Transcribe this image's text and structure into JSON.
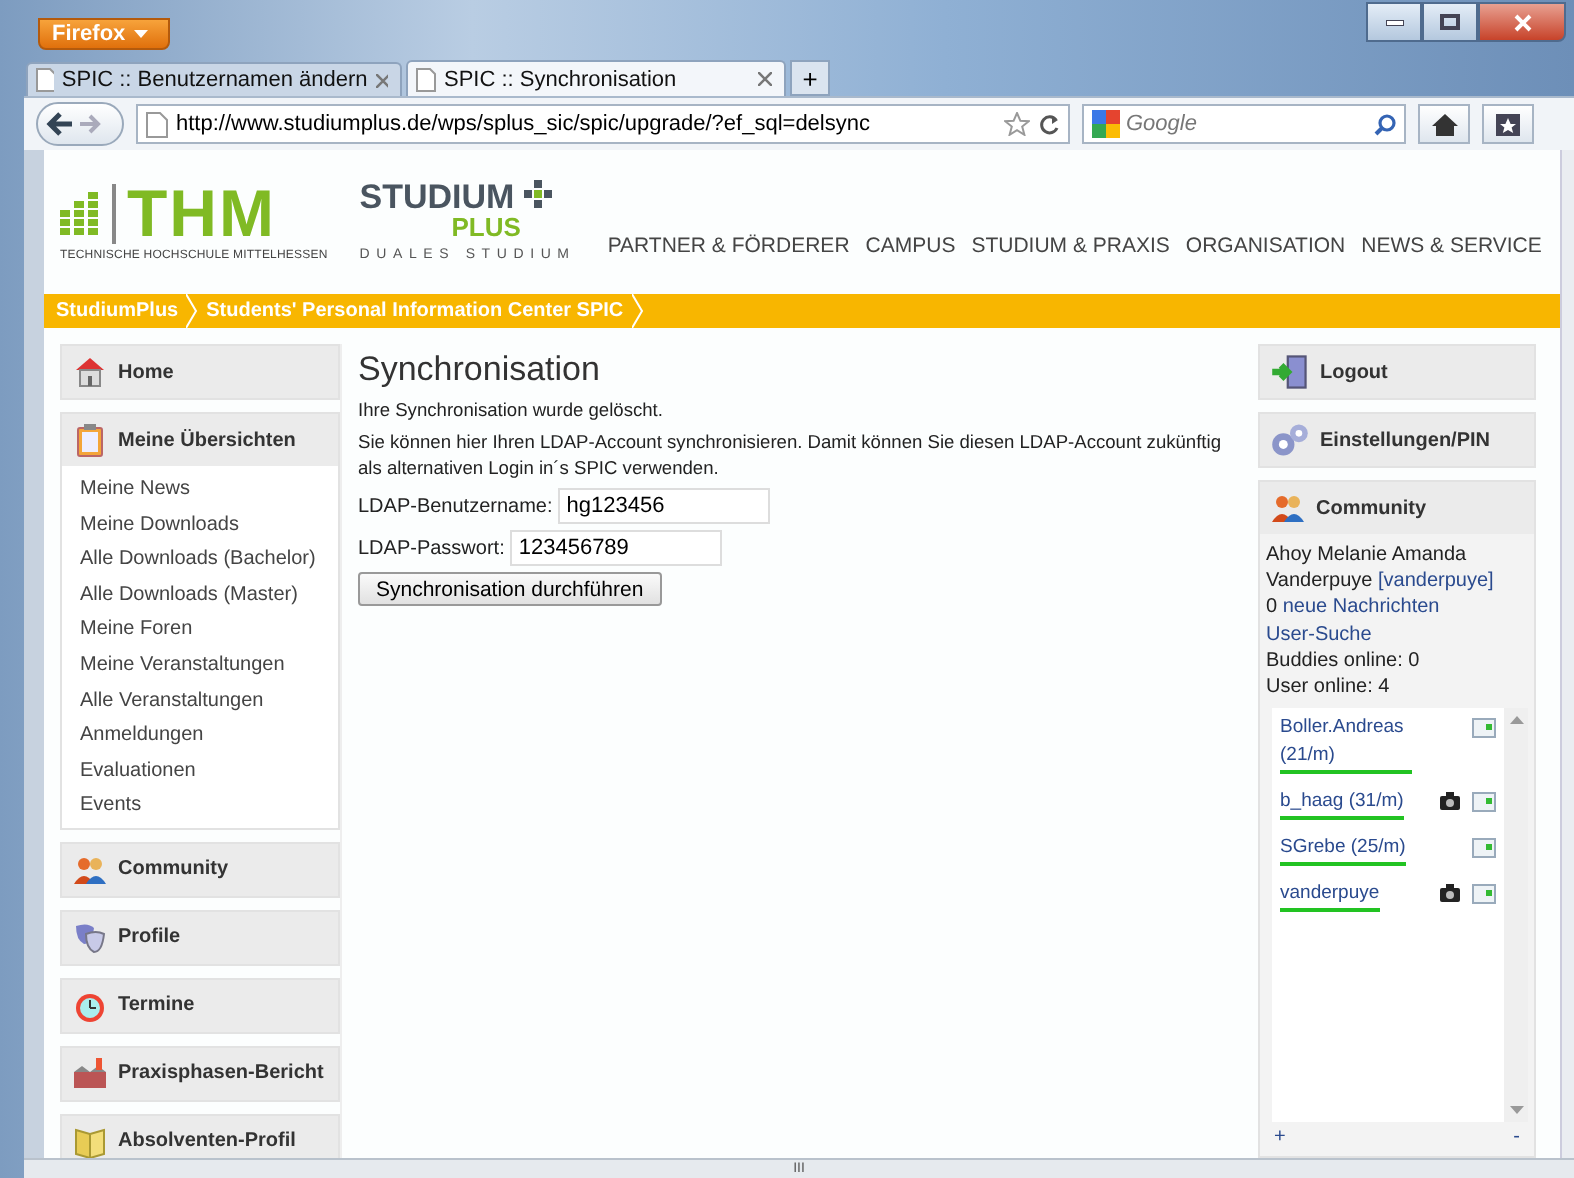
{
  "browser": {
    "menu_button": "Firefox",
    "tabs": [
      {
        "label": "SPIC :: Benutzernamen ändern",
        "selected": false
      },
      {
        "label": "SPIC :: Synchronisation",
        "selected": true
      }
    ],
    "new_tab": "+",
    "url": "http://www.studiumplus.de/wps/splus_sic/spic/upgrade/?ef_sql=delsync",
    "search": {
      "placeholder": "Google"
    }
  },
  "header": {
    "logo": "THM",
    "logo_subtitle": "TECHNISCHE HOCHSCHULE MITTELHESSEN",
    "brand_top": "STUDIUM",
    "brand_bottom": "PLUS",
    "brand_subtitle": "DUALES STUDIUM",
    "nav": [
      "PARTNER & FÖRDERER",
      "CAMPUS",
      "STUDIUM & PRAXIS",
      "ORGANISATION",
      "NEWS & SERVICE"
    ]
  },
  "breadcrumb": [
    "StudiumPlus",
    "Students' Personal Information Center SPIC"
  ],
  "left_menu": [
    {
      "label": "Home"
    },
    {
      "label": "Meine Übersichten",
      "items": [
        "Meine News",
        "Meine Downloads",
        "Alle Downloads (Bachelor)",
        "Alle Downloads (Master)",
        "Meine Foren",
        "Meine Veranstaltungen",
        "Alle Veranstaltungen",
        "Anmeldungen",
        "Evaluationen",
        "Events"
      ]
    },
    {
      "label": "Community"
    },
    {
      "label": "Profile"
    },
    {
      "label": "Termine"
    },
    {
      "label": "Praxisphasen-Bericht"
    },
    {
      "label": "Absolventen-Profil"
    }
  ],
  "main": {
    "title": "Synchronisation",
    "messages": [
      "Ihre Synchronisation wurde gelöscht.",
      "Sie können hier Ihren LDAP-Account synchronisieren. Damit können Sie diesen LDAP-Account zukünftig als alternativen Login in´s SPIC verwenden."
    ],
    "fields": [
      {
        "label": "LDAP-Benutzername:",
        "value": "hg123456"
      },
      {
        "label": "LDAP-Passwort:",
        "value": "123456789"
      }
    ],
    "button": "Synchronisation durchführen"
  },
  "right_menu": [
    "Logout",
    "Einstellungen/PIN"
  ],
  "community": {
    "title": "Community",
    "greeting": "Ahoy Melanie Amanda Vanderpuye",
    "username": "[vanderpuye]",
    "message_count": "0",
    "messages_link": "neue Nachrichten",
    "search_link": "User-Suche",
    "buddies": "Buddies online: 0",
    "users": "User online: 4",
    "online_users": [
      {
        "name": "Boller.Andreas (21/m)",
        "camera": false
      },
      {
        "name": "b_haag (31/m)",
        "camera": true
      },
      {
        "name": "SGrebe (25/m)",
        "camera": false
      },
      {
        "name": "vanderpuye",
        "camera": true
      }
    ],
    "add": "+",
    "remove": "-"
  },
  "scrollbar_grip": "III"
}
